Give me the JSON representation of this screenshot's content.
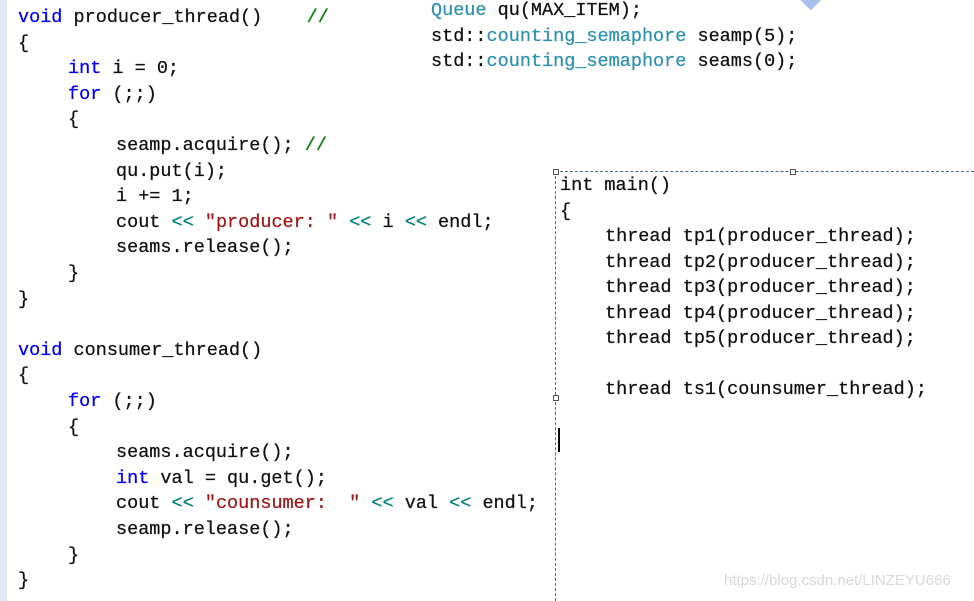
{
  "colors": {
    "keyword": "#0000ff",
    "type": "#2b91af",
    "string": "#a31515",
    "comment": "#008000",
    "operator": "#008080"
  },
  "left_code": [
    {
      "indent": 0,
      "tokens": [
        {
          "t": "void",
          "c": "kw"
        },
        {
          "t": " producer_thread()    "
        },
        {
          "t": "//",
          "c": "cm"
        }
      ]
    },
    {
      "indent": 0,
      "tokens": [
        {
          "t": "{"
        }
      ]
    },
    {
      "indent": 1,
      "tokens": [
        {
          "t": "int",
          "c": "kw"
        },
        {
          "t": " i = 0;"
        }
      ]
    },
    {
      "indent": 1,
      "tokens": [
        {
          "t": "for",
          "c": "kw"
        },
        {
          "t": " (;;)"
        }
      ]
    },
    {
      "indent": 1,
      "tokens": [
        {
          "t": "{"
        }
      ]
    },
    {
      "indent": 2,
      "tokens": [
        {
          "t": "seamp.acquire(); "
        },
        {
          "t": "//",
          "c": "cm"
        }
      ]
    },
    {
      "indent": 2,
      "tokens": [
        {
          "t": "qu.put(i);"
        }
      ]
    },
    {
      "indent": 2,
      "tokens": [
        {
          "t": "i += 1;"
        }
      ]
    },
    {
      "indent": 2,
      "tokens": [
        {
          "t": "cout "
        },
        {
          "t": "<<",
          "c": "op"
        },
        {
          "t": " "
        },
        {
          "t": "\"producer: \"",
          "c": "str"
        },
        {
          "t": " "
        },
        {
          "t": "<<",
          "c": "op"
        },
        {
          "t": " i "
        },
        {
          "t": "<<",
          "c": "op"
        },
        {
          "t": " endl;"
        }
      ]
    },
    {
      "indent": 2,
      "tokens": [
        {
          "t": "seams.release();"
        }
      ]
    },
    {
      "indent": 1,
      "tokens": [
        {
          "t": "}"
        }
      ]
    },
    {
      "indent": 0,
      "tokens": [
        {
          "t": "}"
        }
      ]
    },
    {
      "indent": 0,
      "tokens": []
    },
    {
      "indent": 0,
      "tokens": [
        {
          "t": "void",
          "c": "kw"
        },
        {
          "t": " consumer_thread()"
        }
      ]
    },
    {
      "indent": 0,
      "tokens": [
        {
          "t": "{"
        }
      ]
    },
    {
      "indent": 1,
      "tokens": [
        {
          "t": "for",
          "c": "kw"
        },
        {
          "t": " (;;)"
        }
      ]
    },
    {
      "indent": 1,
      "tokens": [
        {
          "t": "{"
        }
      ]
    },
    {
      "indent": 2,
      "tokens": [
        {
          "t": "seams.acquire();"
        }
      ]
    },
    {
      "indent": 2,
      "tokens": [
        {
          "t": "int",
          "c": "kw"
        },
        {
          "t": " val = qu.get();"
        }
      ]
    },
    {
      "indent": 2,
      "tokens": [
        {
          "t": "cout "
        },
        {
          "t": "<<",
          "c": "op"
        },
        {
          "t": " "
        },
        {
          "t": "\"counsumer:  \"",
          "c": "str"
        },
        {
          "t": " "
        },
        {
          "t": "<<",
          "c": "op"
        },
        {
          "t": " val "
        },
        {
          "t": "<<",
          "c": "op"
        },
        {
          "t": " endl;"
        }
      ]
    },
    {
      "indent": 2,
      "tokens": [
        {
          "t": "seamp.release();"
        }
      ]
    },
    {
      "indent": 1,
      "tokens": [
        {
          "t": "}"
        }
      ]
    },
    {
      "indent": 0,
      "tokens": [
        {
          "t": "}"
        }
      ]
    }
  ],
  "globals_code": [
    {
      "indent": 0,
      "tokens": [
        {
          "t": "Queue",
          "c": "ty"
        },
        {
          "t": " qu(MAX_ITEM);"
        }
      ]
    },
    {
      "indent": 0,
      "tokens": [
        {
          "t": "std::"
        },
        {
          "t": "counting_semaphore",
          "c": "ty"
        },
        {
          "t": " seamp(5);"
        }
      ]
    },
    {
      "indent": 0,
      "tokens": [
        {
          "t": "std::"
        },
        {
          "t": "counting_semaphore",
          "c": "ty"
        },
        {
          "t": " seams(0);"
        }
      ]
    }
  ],
  "main_code": [
    {
      "indent": 0,
      "tokens": [
        {
          "t": "int main()"
        }
      ]
    },
    {
      "indent": 0,
      "tokens": [
        {
          "t": "{"
        }
      ]
    },
    {
      "indent": 1,
      "tokens": [
        {
          "t": "thread tp1(producer_thread);"
        }
      ]
    },
    {
      "indent": 1,
      "tokens": [
        {
          "t": "thread tp2(producer_thread);"
        }
      ]
    },
    {
      "indent": 1,
      "tokens": [
        {
          "t": "thread tp3(producer_thread);"
        }
      ]
    },
    {
      "indent": 1,
      "tokens": [
        {
          "t": "thread tp4(producer_thread);"
        }
      ]
    },
    {
      "indent": 1,
      "tokens": [
        {
          "t": "thread tp5(producer_thread);"
        }
      ]
    },
    {
      "indent": 1,
      "tokens": []
    },
    {
      "indent": 1,
      "tokens": [
        {
          "t": "thread ts1(counsumer_thread);"
        }
      ]
    }
  ],
  "watermark": "https://blog.csdn.net/LINZEYU666"
}
